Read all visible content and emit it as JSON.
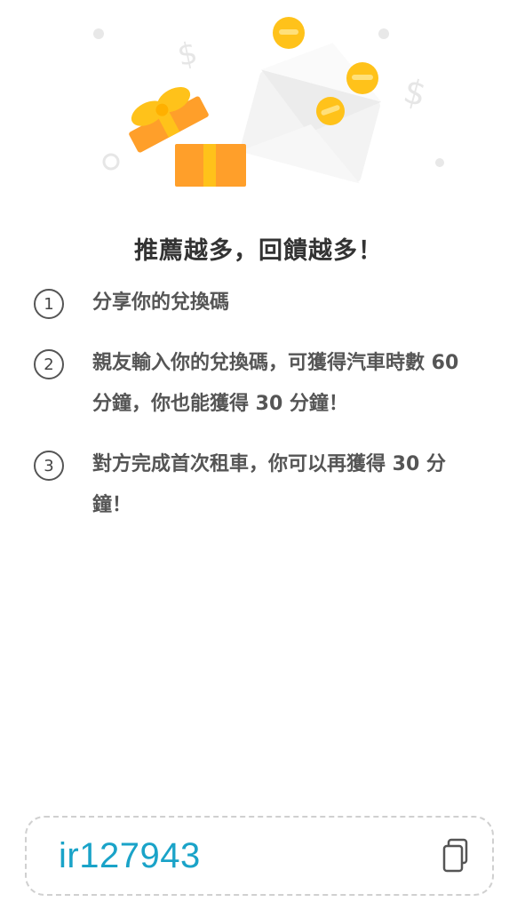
{
  "headline": "推薦越多，回饋越多！",
  "steps": [
    {
      "number": "1",
      "text": "分享你的兌換碼"
    },
    {
      "number": "2",
      "text": "親友輸入你的兌換碼，可獲得汽車時數 60 分鐘，你也能獲得 30 分鐘！"
    },
    {
      "number": "3",
      "text": "對方完成首次租車，你可以再獲得 30 分鐘！"
    }
  ],
  "referral": {
    "code": "ir127943",
    "copy_icon": "copy-icon"
  },
  "illustration": {
    "icons": [
      "gift-icon",
      "envelope-icon",
      "coin-icon",
      "dollar-sign-icon"
    ],
    "colors": {
      "gift": "#ff9f2a",
      "ribbon": "#ffc21a",
      "coin": "#ffc21a",
      "envelope": "#f2f2f2",
      "code": "#1aa3c8"
    }
  }
}
